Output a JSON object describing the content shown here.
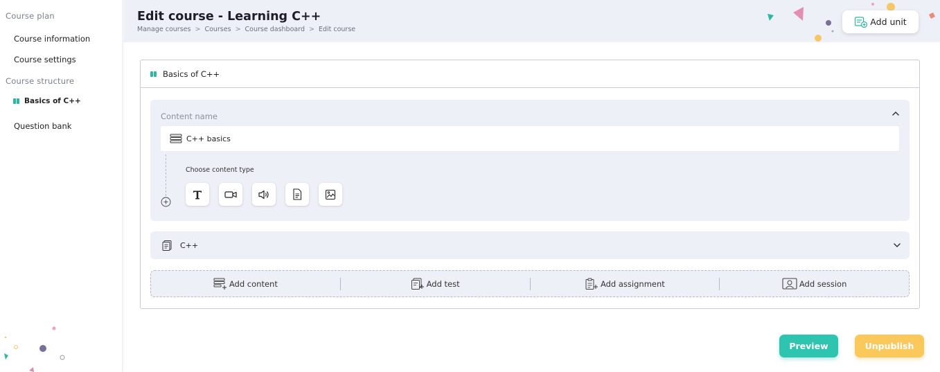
{
  "sidebar": {
    "section_plan": "Course plan",
    "item_info": "Course information",
    "item_settings": "Course settings",
    "section_structure": "Course structure",
    "item_basics": "Basics of C++",
    "item_question_bank": "Question bank"
  },
  "header": {
    "title": "Edit course - Learning C++",
    "breadcrumb": [
      "Manage courses",
      "Courses",
      "Course dashboard",
      "Edit course"
    ],
    "breadcrumb_sep": ">",
    "add_unit_label": "Add unit"
  },
  "unit": {
    "title": "Basics of C++",
    "content_label": "Content name",
    "content_name": "C++ basics",
    "choose_type_label": "Choose content type",
    "content_types": [
      "text-type-icon",
      "video-type-icon",
      "audio-type-icon",
      "document-type-icon",
      "image-type-icon"
    ],
    "test_item_title": "C++",
    "add_content_label": "Add content",
    "add_test_label": "Add test",
    "add_assignment_label": "Add assignment",
    "add_session_label": "Add session"
  },
  "footer": {
    "preview_label": "Preview",
    "unpublish_label": "Unpublish"
  },
  "colors": {
    "accent_teal": "#2ec4b0",
    "accent_yellow": "#fbc85c",
    "panel_bg": "#eef0f7"
  }
}
